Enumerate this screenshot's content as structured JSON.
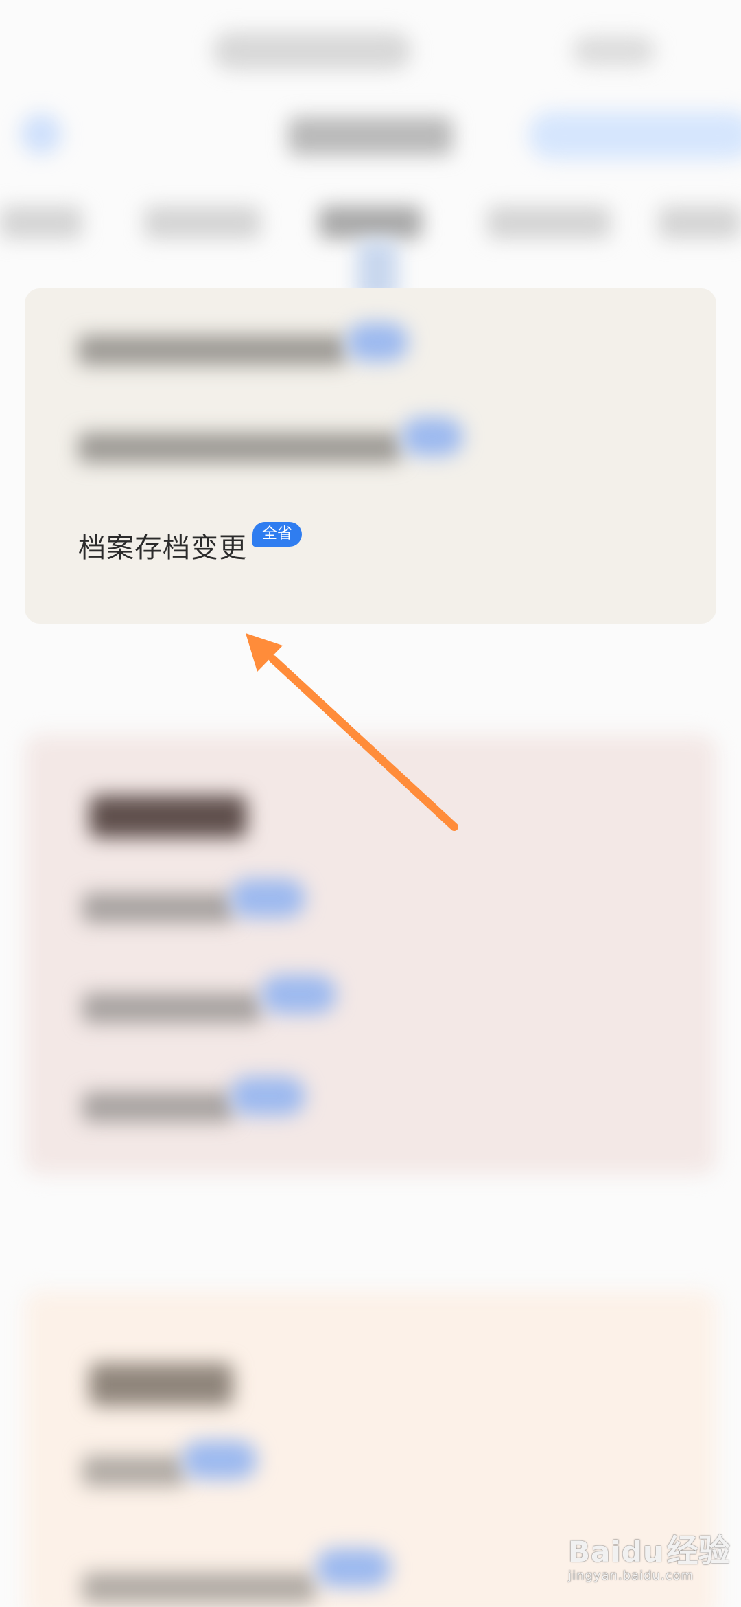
{
  "item": {
    "label": "档案存档变更",
    "badge": "全省"
  },
  "colors": {
    "badge": "#2f7df0",
    "arrow": "#ff8c3a",
    "card_1_bg": "#f3f0ea",
    "card_2_bg": "#f3e8e6",
    "card_3_bg": "#fcf1e8"
  },
  "watermark": {
    "brand": "Baidu",
    "brand_cn": "经验",
    "url": "jingyan.baidu.com"
  }
}
